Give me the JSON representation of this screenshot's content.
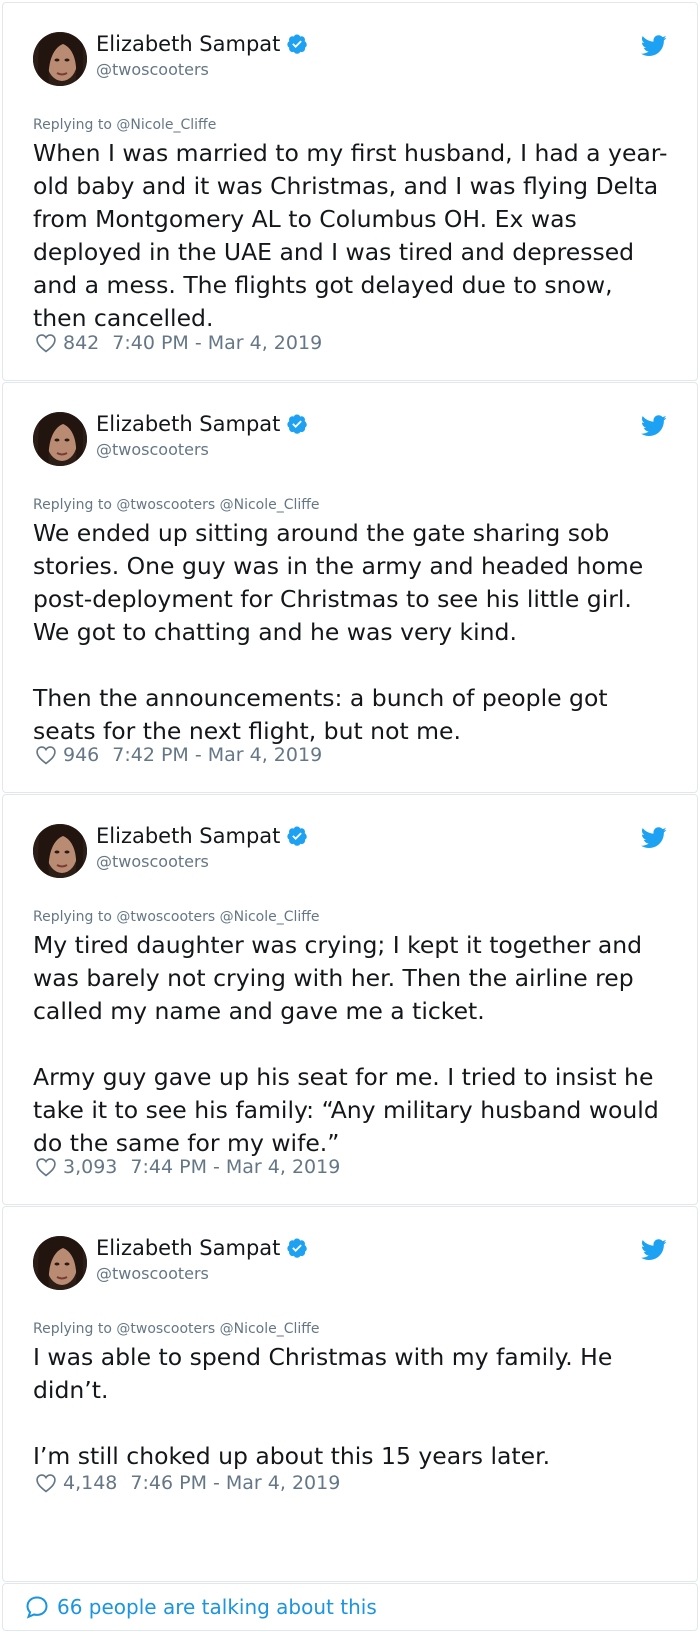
{
  "accent_color": "#1da1f2",
  "link_color": "#1b95e0",
  "tweets": [
    {
      "author_name": "Elizabeth Sampat",
      "author_handle": "@twoscooters",
      "verified_icon": "verified-badge-icon",
      "replying": "Replying to @Nicole_Cliffe",
      "text": "When I was married to my first husband, I had a year-old baby and it was Christmas, and I was flying Delta from Montgomery AL to Columbus OH. Ex was deployed in the UAE and I was tired and depressed and a mess. The flights got delayed due to snow, then cancelled.",
      "likes": "842",
      "timestamp": "7:40 PM - Mar 4, 2019"
    },
    {
      "author_name": "Elizabeth Sampat",
      "author_handle": "@twoscooters",
      "verified_icon": "verified-badge-icon",
      "replying": "Replying to @twoscooters @Nicole_Cliffe",
      "text": "We ended up sitting around the gate sharing sob stories. One guy was in the army and headed home post-deployment for Christmas to see his little girl. We got to chatting and he was very kind.\n\nThen the announcements: a bunch of people got seats for the next flight, but not me.",
      "likes": "946",
      "timestamp": "7:42 PM - Mar 4, 2019"
    },
    {
      "author_name": "Elizabeth Sampat",
      "author_handle": "@twoscooters",
      "verified_icon": "verified-badge-icon",
      "replying": "Replying to @twoscooters @Nicole_Cliffe",
      "text": "My tired daughter was crying; I kept it together and was barely not crying with her. Then the airline rep called my name and gave me a ticket.\n\nArmy guy gave up his seat for me. I tried to insist he take it to see his family: “Any military husband would do the same for my wife.”",
      "likes": "3,093",
      "timestamp": "7:44 PM - Mar 4, 2019"
    },
    {
      "author_name": "Elizabeth Sampat",
      "author_handle": "@twoscooters",
      "verified_icon": "verified-badge-icon",
      "replying": "Replying to @twoscooters @Nicole_Cliffe",
      "text": "I was able to spend Christmas with my family. He didn’t.\n\nI’m still choked up about this 15 years later.",
      "likes": "4,148",
      "timestamp": "7:46 PM - Mar 4, 2019"
    }
  ],
  "footer": {
    "icon": "speech-bubble-icon",
    "text": "66 people are talking about this"
  }
}
